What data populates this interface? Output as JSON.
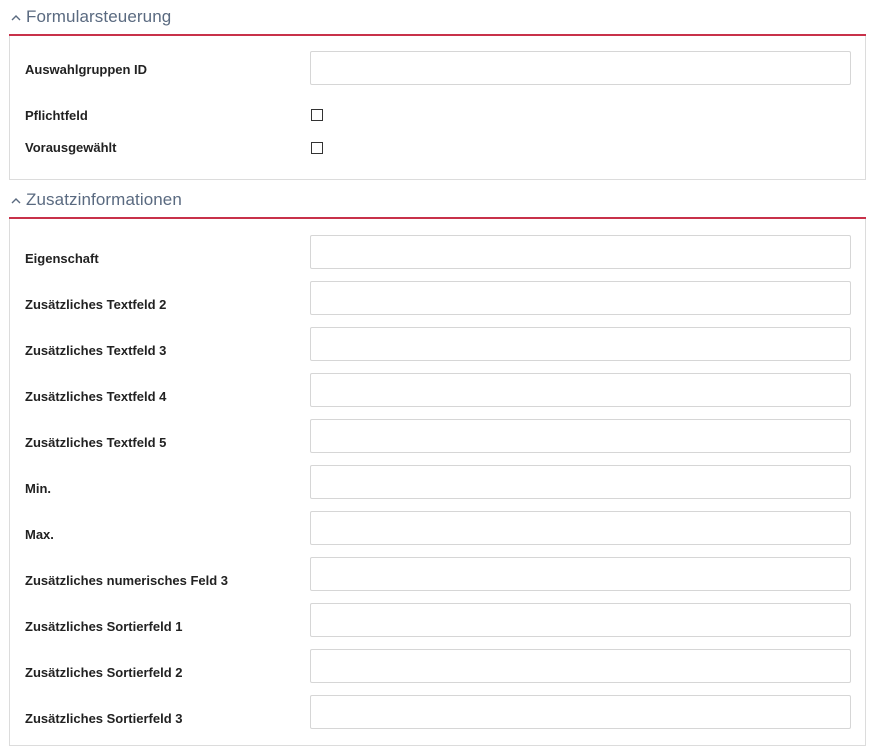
{
  "sections": [
    {
      "title": "Formularsteuerung",
      "fields": [
        {
          "label": "Auswahlgruppen ID",
          "type": "text",
          "value": ""
        },
        {
          "label": "Pflichtfeld",
          "type": "checkbox",
          "checked": false
        },
        {
          "label": "Vorausgewählt",
          "type": "checkbox",
          "checked": false
        }
      ]
    },
    {
      "title": "Zusatzinformationen",
      "fields": [
        {
          "label": "Eigenschaft",
          "type": "text",
          "value": ""
        },
        {
          "label": "Zusätzliches Textfeld 2",
          "type": "text",
          "value": ""
        },
        {
          "label": "Zusätzliches Textfeld 3",
          "type": "text",
          "value": ""
        },
        {
          "label": "Zusätzliches Textfeld 4",
          "type": "text",
          "value": ""
        },
        {
          "label": "Zusätzliches Textfeld 5",
          "type": "text",
          "value": ""
        },
        {
          "label": "Min.",
          "type": "text",
          "value": ""
        },
        {
          "label": "Max.",
          "type": "text",
          "value": ""
        },
        {
          "label": "Zusätzliches numerisches Feld 3",
          "type": "text",
          "value": ""
        },
        {
          "label": "Zusätzliches Sortierfeld 1",
          "type": "text",
          "value": ""
        },
        {
          "label": "Zusätzliches Sortierfeld 2",
          "type": "text",
          "value": ""
        },
        {
          "label": "Zusätzliches Sortierfeld 3",
          "type": "text",
          "value": ""
        }
      ]
    }
  ],
  "icons": {
    "collapse": "chevron-up-icon"
  },
  "colors": {
    "accent_underline": "#c8314a",
    "section_title": "#5a6a80",
    "border": "#dcdcdc"
  }
}
